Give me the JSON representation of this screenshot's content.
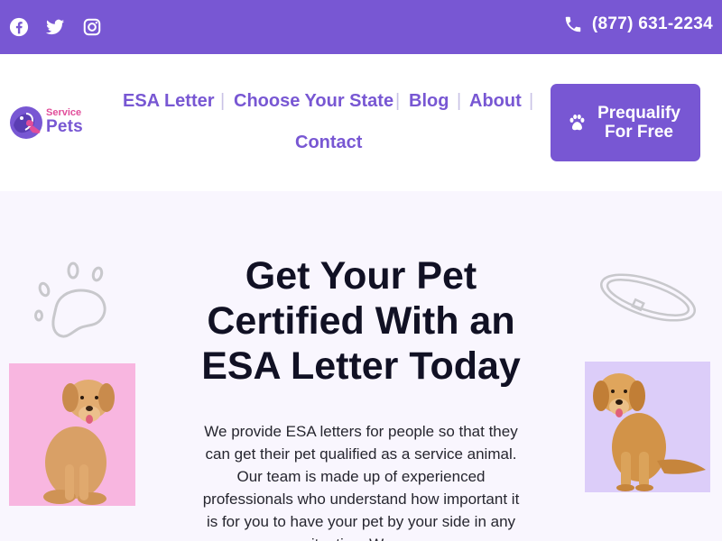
{
  "topbar": {
    "social": [
      {
        "icon": "facebook-icon"
      },
      {
        "icon": "twitter-icon"
      },
      {
        "icon": "instagram-icon"
      }
    ],
    "phone": "(877) 631-2234",
    "phone_icon": "phone-icon"
  },
  "logo": {
    "top": "Service",
    "bottom": "Pets"
  },
  "nav": {
    "items": [
      "ESA Letter",
      "Choose Your State",
      "Blog",
      "About",
      "Contact"
    ],
    "separator": "|"
  },
  "cta": {
    "label": "Prequalify For Free",
    "icon": "paw-icon"
  },
  "hero": {
    "title": "Get Your Pet Certified With an ESA Letter Today",
    "text": "We provide ESA letters for people so that they can get their pet qualified as a service animal. Our team is made up of experienced professionals who understand how important it is for you to have your pet by your side in any situation. We are"
  },
  "colors": {
    "brand": "#7857d3",
    "pink": "#e14d9a",
    "hero_bg": "#f9f6fe",
    "dog_left_bg": "#f8b6e0",
    "dog_right_bg": "#dccdf9"
  }
}
